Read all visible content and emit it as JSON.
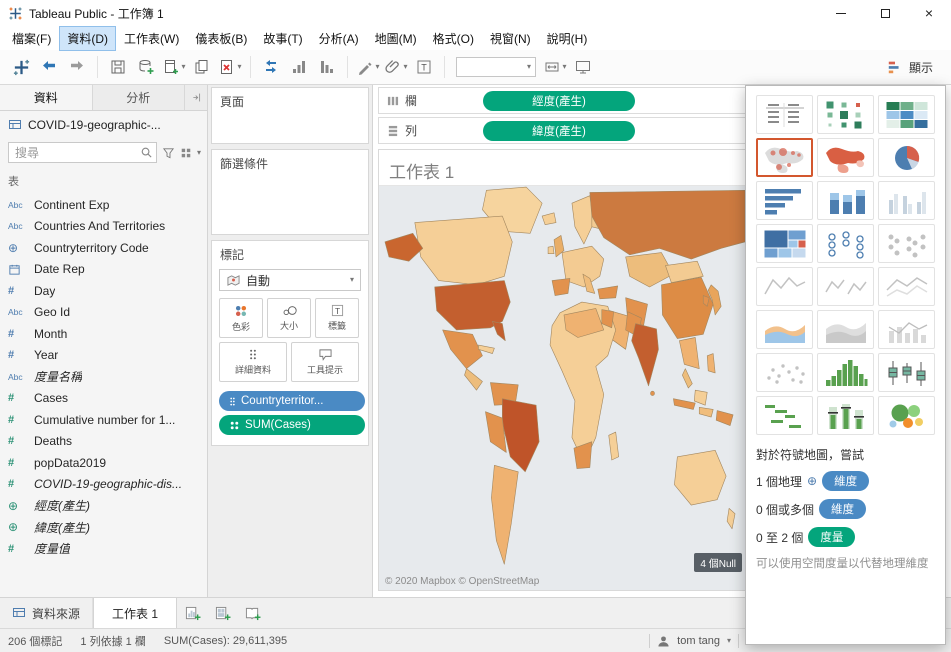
{
  "colors": {
    "pill_green": "#04a57c",
    "pill_blue": "#4a8ac4",
    "selected_border": "#d3572e"
  },
  "titlebar": {
    "title": "Tableau Public - 工作簿 1"
  },
  "menu": {
    "items": [
      "檔案(F)",
      "資料(D)",
      "工作表(W)",
      "儀表板(B)",
      "故事(T)",
      "分析(A)",
      "地圖(M)",
      "格式(O)",
      "視窗(N)",
      "說明(H)"
    ]
  },
  "toolbar": {
    "show_me": "顯示"
  },
  "data_pane": {
    "tab_data": "資料",
    "tab_analytics": "分析",
    "datasource": "COVID-19-geographic-...",
    "search_placeholder": "搜尋",
    "section_tables": "表",
    "fields": [
      {
        "label": "Continent Exp"
      },
      {
        "label": "Countries And Territories"
      },
      {
        "label": "Countryterritory Code"
      },
      {
        "label": "Date Rep"
      },
      {
        "label": "Day"
      },
      {
        "label": "Geo Id"
      },
      {
        "label": "Month"
      },
      {
        "label": "Year"
      },
      {
        "label": "度量名稱"
      },
      {
        "label": "Cases"
      },
      {
        "label": "Cumulative number for 1..."
      },
      {
        "label": "Deaths"
      },
      {
        "label": "popData2019"
      },
      {
        "label": "COVID-19-geographic-dis..."
      },
      {
        "label": "經度(產生)"
      },
      {
        "label": "緯度(產生)"
      },
      {
        "label": "度量值"
      }
    ]
  },
  "cards": {
    "pages": "頁面",
    "filters": "篩選條件",
    "marks": "標記",
    "mark_type": "自動",
    "buttons": [
      {
        "label": "色彩"
      },
      {
        "label": "大小"
      },
      {
        "label": "標籤"
      },
      {
        "label": "詳細資料"
      },
      {
        "label": "工具提示"
      }
    ],
    "pills": [
      {
        "label": "Countryterritor..."
      },
      {
        "label": "SUM(Cases)"
      }
    ]
  },
  "shelves": {
    "columns_label": "欄",
    "rows_label": "列",
    "columns_pill": "經度(產生)",
    "rows_pill": "緯度(產生)"
  },
  "sheet": {
    "title": "工作表 1",
    "attribution": "© 2020 Mapbox © OpenStreetMap",
    "null_badge": "4 個Null"
  },
  "show_me": {
    "hint_title": "對於符號地圖，嘗試",
    "req1_prefix": "1 個地理",
    "req1_pill": "維度",
    "req2_prefix": "0 個或多個",
    "req2_pill": "維度",
    "req3_prefix": "0 至 2 個",
    "req3_pill": "度量",
    "footnote": "可以使用空間度量以代替地理維度",
    "selected": "symbol-map",
    "chart_types": [
      "text-table",
      "heat-map",
      "highlight-table",
      "symbol-map",
      "filled-map",
      "pie-chart",
      "horizontal-bars",
      "stacked-bars",
      "side-by-side-bars",
      "treemap",
      "circle-views",
      "side-by-side-circles",
      "lines-continuous",
      "lines-discrete",
      "dual-lines",
      "area-continuous",
      "area-discrete",
      "dual-combination",
      "scatter-plot",
      "histogram",
      "box-and-whisker",
      "gantt",
      "bullet-graph",
      "packed-bubbles"
    ]
  },
  "tabs": {
    "datasource": "資料來源",
    "sheet1": "工作表 1"
  },
  "statusbar": {
    "marks": "206 個標記",
    "rows_cols": "1 列依據 1 欄",
    "aggregate": "SUM(Cases): 29,611,395",
    "user": "tom tang"
  }
}
